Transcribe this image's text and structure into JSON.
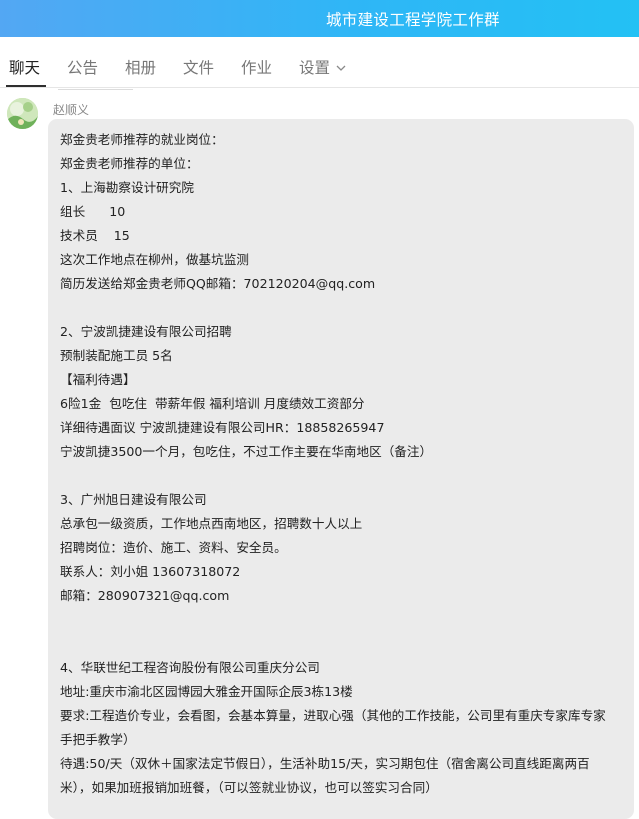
{
  "window": {
    "title": "城市建设工程学院工作群"
  },
  "tabs": [
    {
      "label": "聊天",
      "active": true
    },
    {
      "label": "公告",
      "active": false
    },
    {
      "label": "相册",
      "active": false
    },
    {
      "label": "文件",
      "active": false
    },
    {
      "label": "作业",
      "active": false
    },
    {
      "label": "设置",
      "active": false
    }
  ],
  "message": {
    "sender": "赵顺义",
    "lines": [
      "郑金贵老师推荐的就业岗位：",
      "郑金贵老师推荐的单位：",
      "1、上海勘察设计研究院",
      "组长      10",
      "技术员    15",
      "这次工作地点在柳州，做基坑监测",
      "简历发送给郑金贵老师QQ邮箱：702120204@qq.com",
      "",
      "2、宁波凯捷建设有限公司招聘",
      "预制装配施工员 5名",
      "【福利待遇】",
      "6险1金  包吃住  带薪年假 福利培训 月度绩效工资部分",
      "详细待遇面议 宁波凯捷建设有限公司HR：18858265947",
      "宁波凯捷3500一个月，包吃住，不过工作主要在华南地区（备注）",
      "",
      "3、广州旭日建设有限公司",
      "总承包一级资质，工作地点西南地区，招聘数十人以上",
      "招聘岗位：造价、施工、资料、安全员。",
      "联系人：刘小姐 13607318072",
      "邮箱：280907321@qq.com",
      "",
      "",
      "4、华联世纪工程咨询股份有限公司重庆分公司",
      "地址:重庆市渝北区园博园大雅金开国际企辰3栋13楼",
      "要求:工程造价专业，会看图，会基本算量，进取心强（其他的工作技能，公司里有重庆专家库专家",
      "手把手教学）",
      "待遇:50/天（双休＋国家法定节假日），生活补助15/天，实习期包住（宿舍离公司直线距离两百",
      "米），如果加班报销加班餐，（可以签就业协议，也可以签实习合同）"
    ]
  }
}
